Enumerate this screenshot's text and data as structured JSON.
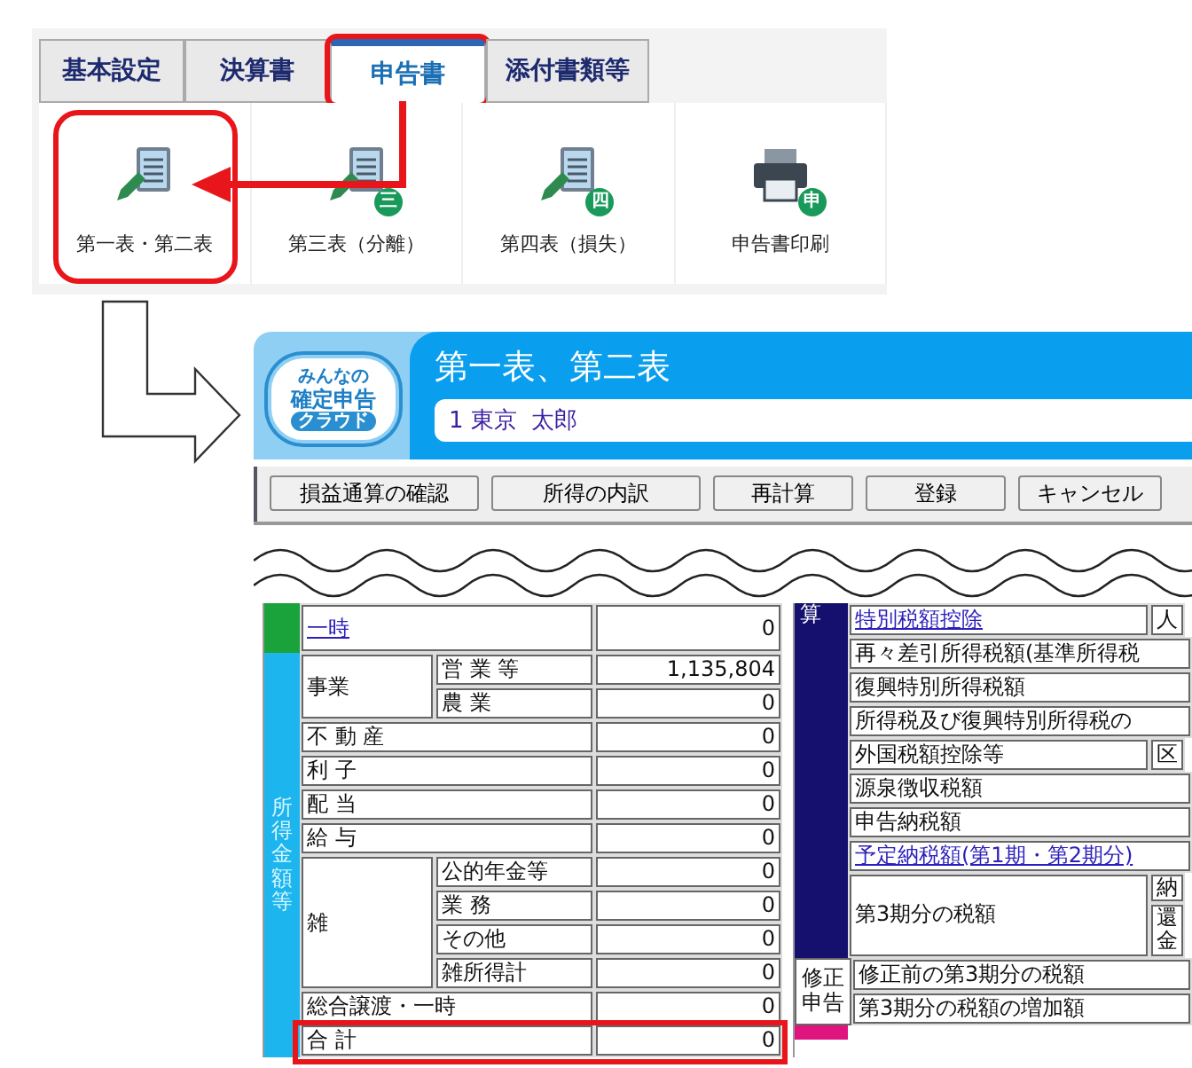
{
  "ribbon_window": {
    "tabs": [
      {
        "label": "基本設定",
        "selected": false,
        "highlighted": false
      },
      {
        "label": "決算書",
        "selected": false,
        "highlighted": false
      },
      {
        "label": "申告書",
        "selected": true,
        "highlighted": true
      },
      {
        "label": "添付書類等",
        "selected": false,
        "highlighted": false
      }
    ],
    "buttons": [
      {
        "kind": "form",
        "label": "第一表・第二表",
        "highlighted": true
      },
      {
        "kind": "form",
        "label": "第三表（分離）",
        "badge": "三",
        "highlighted": false
      },
      {
        "kind": "form",
        "label": "第四表（損失）",
        "badge": "四",
        "highlighted": false
      },
      {
        "kind": "print",
        "label": "申告書印刷",
        "badge": "申",
        "highlighted": false
      }
    ]
  },
  "form_window": {
    "logo": [
      "みんなの",
      "確定申告",
      "クラウド"
    ],
    "title": "第一表、第二表",
    "name_field": "1 東京  太郎",
    "toolbar": [
      "損益通算の確認",
      "所得の内訳",
      "再計算",
      "登録",
      "キャンセル"
    ],
    "income_table": [
      {
        "color": "#1aa33a",
        "rows": [
          {
            "label": "一時",
            "link": true,
            "value": "0"
          }
        ]
      },
      {
        "label": "所得金額等",
        "color": "#1cb5ee",
        "rows": [
          {
            "label": "事業",
            "sub": [
              {
                "label": "営 業 等",
                "value": "1,135,804"
              },
              {
                "label": "農 業",
                "value": "0"
              }
            ]
          },
          {
            "label": "不 動 産",
            "value": "0"
          },
          {
            "label": "利 子",
            "value": "0"
          },
          {
            "label": "配 当",
            "value": "0"
          },
          {
            "label": "給 与",
            "value": "0"
          },
          {
            "label": "雑",
            "sub": [
              {
                "label": "公的年金等",
                "value": "0"
              },
              {
                "label": "業 務",
                "value": "0"
              },
              {
                "label": "その他",
                "value": "0"
              },
              {
                "label": "雑所得計",
                "value": "0"
              }
            ]
          },
          {
            "label": "総合譲渡・一時",
            "value": "0"
          },
          {
            "label": "合 計",
            "value": "0",
            "highlighted": true
          }
        ]
      }
    ],
    "tax_table": [
      {
        "label": "算",
        "color": "#15106e",
        "rows": [
          {
            "label": "特別税額控除",
            "link": true,
            "extra": [
              "人"
            ]
          },
          {
            "label": "再々差引所得税額(基準所得税"
          },
          {
            "label": "復興特別所得税額"
          },
          {
            "label": "所得税及び復興特別所得税の"
          },
          {
            "label": "外国税額控除等",
            "extra": [
              "区"
            ]
          },
          {
            "label": "源泉徴収税額"
          },
          {
            "label": "申告納税額"
          },
          {
            "label": "予定納税額(第1期・第2期分)",
            "link": true
          },
          {
            "label": "第3期分の税額",
            "extra": [
              "納",
              "還金"
            ]
          }
        ]
      },
      {
        "label": "修正申告",
        "color": "#ffffff",
        "rows": [
          {
            "label": "修正前の第3期分の税額"
          },
          {
            "label": "第3期分の税額の増加額"
          }
        ]
      },
      {
        "color": "#e0147f"
      }
    ]
  }
}
